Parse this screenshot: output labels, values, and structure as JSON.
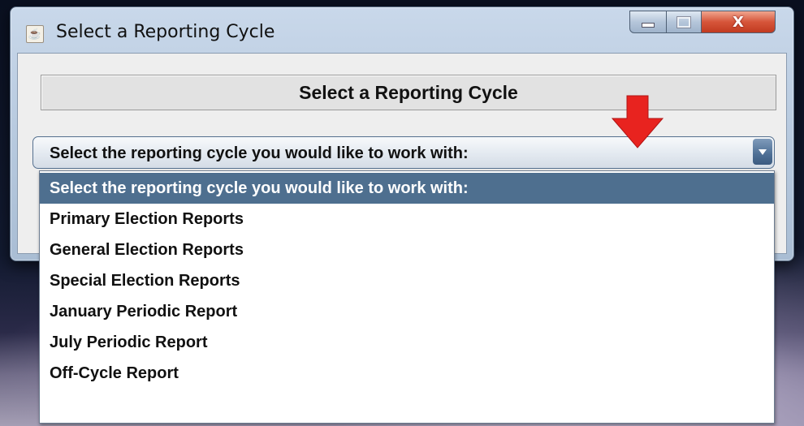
{
  "window": {
    "title": "Select a Reporting Cycle",
    "controls": {
      "minimize": "minimize",
      "maximize": "maximize",
      "close": "X"
    }
  },
  "dialog": {
    "heading": "Select a Reporting Cycle",
    "combo": {
      "selected": "Select the reporting cycle you would like to work with:"
    },
    "options": [
      "Select the reporting cycle you would like to work with:",
      "Primary Election Reports",
      "General Election Reports",
      "Special Election Reports",
      "January Periodic  Report",
      "July Periodic Report",
      "Off-Cycle Report"
    ],
    "highlighted_option_index": 0
  },
  "colors": {
    "highlight": "#4e6f8f",
    "annotation_arrow": "#e8231f",
    "close_button": "#c94a2f"
  }
}
